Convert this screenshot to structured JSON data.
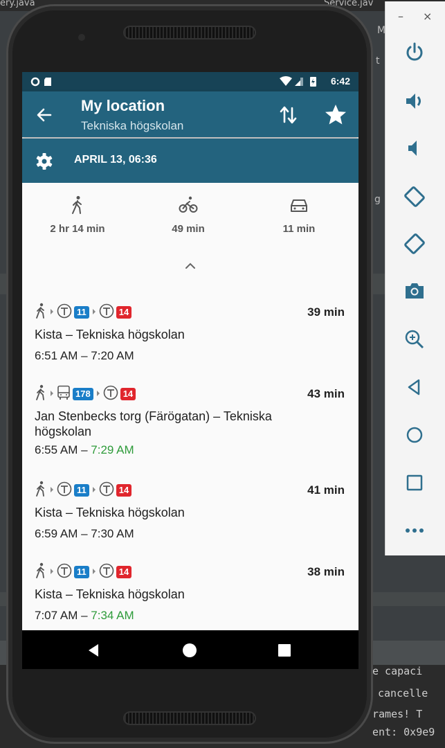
{
  "ide": {
    "top_left_text": "ery.java",
    "top_right_text": "Service.jav",
    "side_text_1": "M",
    "side_text_2": "t",
    "side_text_3": "g",
    "console_lines": [
      "e capaci",
      "cancelle",
      "rames!  T",
      "ent: 0x9e9"
    ]
  },
  "emulator_window": {
    "minimize": "–",
    "close": "×",
    "buttons": [
      "power",
      "volume-up",
      "volume-down",
      "rotate-left",
      "rotate-right",
      "screenshot",
      "zoom",
      "back",
      "home",
      "overview",
      "more"
    ]
  },
  "status_bar": {
    "time": "6:42"
  },
  "app_bar": {
    "title": "My location",
    "subtitle": "Tekniska högskolan"
  },
  "date_bar": {
    "date": "APRIL 13, 06:36"
  },
  "modes": [
    {
      "name": "walk",
      "label": "2 hr 14 min"
    },
    {
      "name": "bike",
      "label": "49 min"
    },
    {
      "name": "car",
      "label": "11 min"
    }
  ],
  "trips": [
    {
      "duration": "39 min",
      "route": "Kista – Tekniska högskolan",
      "depart": "6:51 AM",
      "sep": " – ",
      "arrive": "7:20 AM",
      "arrive_highlight": false,
      "legs": [
        {
          "type": "metro",
          "line": "11",
          "color": "#1a7ec8"
        },
        {
          "type": "metro",
          "line": "14",
          "color": "#e0262d"
        }
      ]
    },
    {
      "duration": "43 min",
      "route": "Jan Stenbecks torg (Färögatan) – Tekniska högskolan",
      "depart": "6:55 AM",
      "sep": " – ",
      "arrive": "7:29 AM",
      "arrive_highlight": true,
      "legs": [
        {
          "type": "bus",
          "line": "178",
          "color": "#1a7ec8"
        },
        {
          "type": "metro",
          "line": "14",
          "color": "#e0262d"
        }
      ]
    },
    {
      "duration": "41 min",
      "route": "Kista – Tekniska högskolan",
      "depart": "6:59 AM",
      "sep": " – ",
      "arrive": "7:30 AM",
      "arrive_highlight": false,
      "legs": [
        {
          "type": "metro",
          "line": "11",
          "color": "#1a7ec8"
        },
        {
          "type": "metro",
          "line": "14",
          "color": "#e0262d"
        }
      ]
    },
    {
      "duration": "38 min",
      "route": "Kista – Tekniska högskolan",
      "depart": "7:07 AM",
      "sep": " – ",
      "arrive": "7:34 AM",
      "arrive_highlight": true,
      "legs": [
        {
          "type": "metro",
          "line": "11",
          "color": "#1a7ec8"
        },
        {
          "type": "metro",
          "line": "14",
          "color": "#e0262d"
        }
      ]
    }
  ],
  "colors": {
    "status_bar": "#174356",
    "app_bar": "#23637e",
    "arrive_green": "#2e9b3a",
    "line_blue": "#1a7ec8",
    "line_red": "#e0262d"
  }
}
